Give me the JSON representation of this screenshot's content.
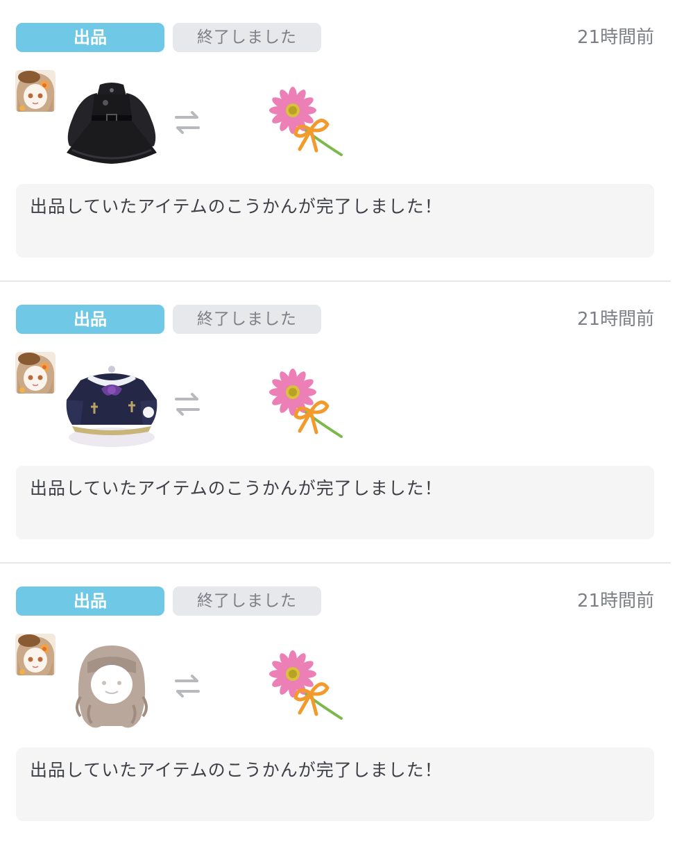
{
  "notifications": [
    {
      "type_tag": "出品",
      "status_tag": "終了しました",
      "time_ago": "21時間前",
      "item_icon": "black-dress-icon",
      "reward_icon": "pink-flower-icon",
      "message": "出品していたアイテムのこうかんが完了しました！"
    },
    {
      "type_tag": "出品",
      "status_tag": "終了しました",
      "time_ago": "21時間前",
      "item_icon": "navy-sailor-dress-icon",
      "reward_icon": "pink-flower-icon",
      "message": "出品していたアイテムのこうかんが完了しました！"
    },
    {
      "type_tag": "出品",
      "status_tag": "終了しました",
      "time_ago": "21時間前",
      "item_icon": "wavy-hair-icon",
      "reward_icon": "pink-flower-icon",
      "message": "出品していたアイテムのこうかんが完了しました！"
    }
  ],
  "colors": {
    "listing_tag": "#6ec8e6",
    "status_tag_bg": "#e7e8eb",
    "status_tag_text": "#7c7f87",
    "message_bg": "#f5f5f6",
    "divider": "#e6e7ea"
  }
}
